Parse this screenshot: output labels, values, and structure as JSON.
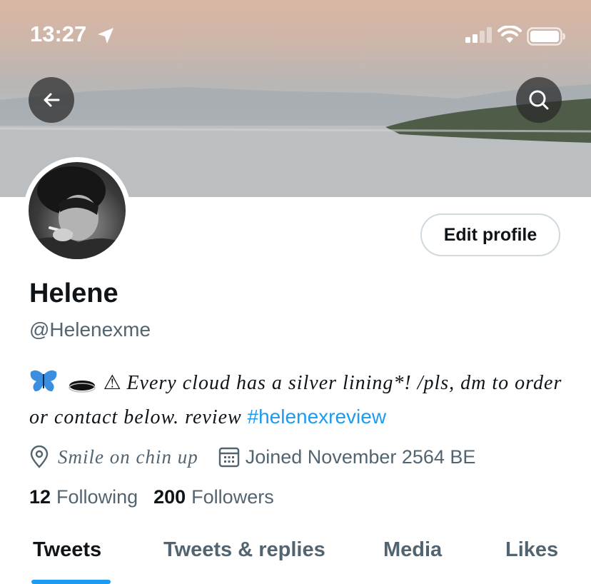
{
  "status_bar": {
    "time": "13:27"
  },
  "profile": {
    "name": "Helene",
    "handle": "@Helenexme",
    "edit_button": "Edit profile",
    "bio_symbols": "⚠",
    "bio_text": "Every cloud has a silver lining*! /pls, dm to order or contact below. review",
    "bio_hashtag": "#helenexreview",
    "location": "Smile on chin up",
    "joined": "Joined November 2564 BE",
    "following_count": "12",
    "following_label": "Following",
    "followers_count": "200",
    "followers_label": "Followers"
  },
  "tabs": [
    {
      "label": "Tweets",
      "active": true
    },
    {
      "label": "Tweets & replies",
      "active": false
    },
    {
      "label": "Media",
      "active": false
    },
    {
      "label": "Likes",
      "active": false
    }
  ],
  "colors": {
    "accent": "#1d9bf0",
    "secondary_text": "#536471",
    "primary_text": "#0f1419"
  },
  "icons": [
    "back-arrow-icon",
    "search-icon",
    "location-icon",
    "calendar-icon",
    "butterfly-icon",
    "hole-icon",
    "warning-icon"
  ]
}
